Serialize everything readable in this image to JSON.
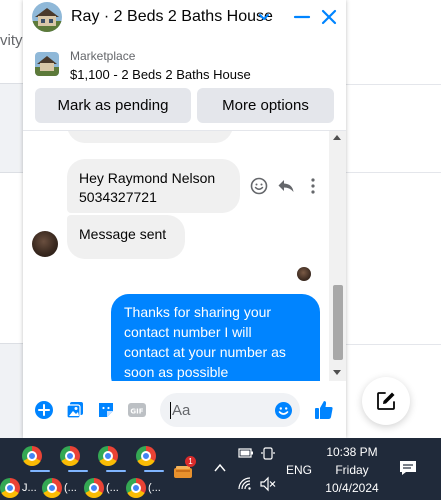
{
  "background": {
    "activity_text": "vity"
  },
  "chat": {
    "title": "Ray · 2 Beds 2 Baths House",
    "listing": {
      "source": "Marketplace",
      "title": "$1,100 - 2 Beds 2 Baths House"
    },
    "actions": {
      "pending_label": "Mark as pending",
      "more_label": "More options"
    },
    "messages": [
      {
        "from": "them",
        "lines": [
          "Hey Raymond Nelson",
          "5034327721"
        ]
      },
      {
        "from": "them",
        "lines": [
          "Message sent"
        ]
      },
      {
        "from": "me",
        "lines": [
          "Thanks for sharing your",
          "contact number I will",
          "contact at your number as",
          "soon as possible"
        ]
      }
    ],
    "composer": {
      "placeholder": "Aa"
    },
    "colors": {
      "accent": "#0084ff",
      "incoming_bubble": "#f0f0f0"
    }
  },
  "taskbar": {
    "items": [
      {
        "label": "",
        "icon": "chrome-icon"
      },
      {
        "label": "",
        "icon": "chrome-icon"
      },
      {
        "label": "",
        "icon": "chrome-icon"
      },
      {
        "label": "",
        "icon": "chrome-icon"
      },
      {
        "label": "J...",
        "icon": "chrome-icon"
      },
      {
        "label": "(...",
        "icon": "chrome-icon"
      },
      {
        "label": "(...",
        "icon": "chrome-icon"
      },
      {
        "label": "(...",
        "icon": "chrome-icon"
      }
    ],
    "mail_badge": "1",
    "language": "ENG",
    "time": "10:38 PM",
    "day": "Friday",
    "date": "10/4/2024"
  }
}
